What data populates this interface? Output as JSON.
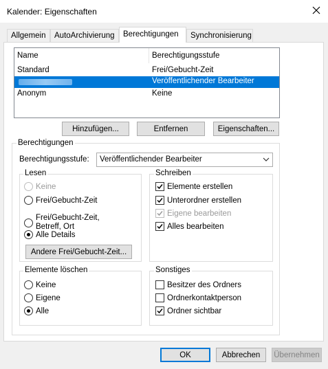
{
  "window": {
    "title": "Kalender: Eigenschaften"
  },
  "tabs": [
    {
      "label": "Allgemein"
    },
    {
      "label": "AutoArchivierung"
    },
    {
      "label": "Berechtigungen"
    },
    {
      "label": "Synchronisierung"
    }
  ],
  "permissions_list": {
    "col_name": "Name",
    "col_level": "Berechtigungsstufe",
    "rows": [
      {
        "name": "Standard",
        "level": "Frei/Gebucht-Zeit"
      },
      {
        "name": "",
        "level": "Veröffentlichender Bearbeiter"
      },
      {
        "name": "Anonym",
        "level": "Keine"
      }
    ]
  },
  "list_buttons": {
    "add": "Hinzufügen...",
    "remove": "Entfernen",
    "properties": "Eigenschaften..."
  },
  "permissions": {
    "group_label": "Berechtigungen",
    "level_label": "Berechtigungsstufe:",
    "level_value": "Veröffentlichender Bearbeiter"
  },
  "read": {
    "label": "Lesen",
    "options": [
      "Keine",
      "Frei/Gebucht-Zeit",
      "Frei/Gebucht-Zeit,",
      "Betreff, Ort",
      "Alle Details"
    ],
    "other_button": "Andere Frei/Gebucht-Zeit..."
  },
  "write": {
    "label": "Schreiben",
    "options": [
      "Elemente erstellen",
      "Unterordner erstellen",
      "Eigene bearbeiten",
      "Alles bearbeiten"
    ]
  },
  "delete": {
    "label": "Elemente löschen",
    "options": [
      "Keine",
      "Eigene",
      "Alle"
    ]
  },
  "other": {
    "label": "Sonstiges",
    "options": [
      "Besitzer des Ordners",
      "Ordnerkontaktperson",
      "Ordner sichtbar"
    ]
  },
  "footer": {
    "ok": "OK",
    "cancel": "Abbrechen",
    "apply": "Übernehmen"
  }
}
